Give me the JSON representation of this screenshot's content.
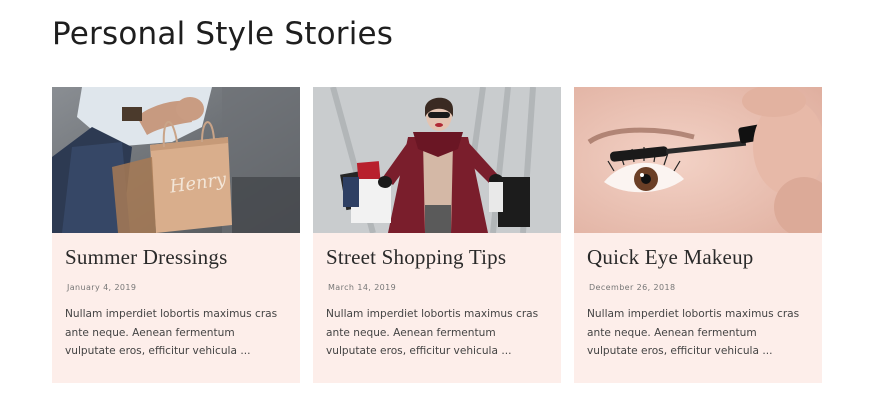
{
  "section": {
    "title": "Personal Style Stories"
  },
  "posts": [
    {
      "title": "Summer Dressings",
      "date": "January 4, 2019",
      "excerpt": "Nullam imperdiet lobortis maximus cras ante neque. Aenean fermentum vulputate eros, efficitur vehicula ...",
      "image": "woman-with-shopping-bags-photo",
      "image_text": "Henry"
    },
    {
      "title": "Street Shopping Tips",
      "date": "March 14, 2019",
      "excerpt": "Nullam imperdiet lobortis maximus cras ante neque. Aenean fermentum vulputate eros, efficitur vehicula ...",
      "image": "woman-in-red-coat-with-bags-photo"
    },
    {
      "title": "Quick Eye Makeup",
      "date": "December 26, 2018",
      "excerpt": "Nullam imperdiet lobortis maximus cras ante neque. Aenean fermentum vulputate eros, efficitur vehicula ...",
      "image": "eye-mascara-closeup-photo"
    }
  ],
  "colors": {
    "card_background": "#fdeeea",
    "title_text": "#1e1e1e",
    "body_text": "#444444"
  }
}
